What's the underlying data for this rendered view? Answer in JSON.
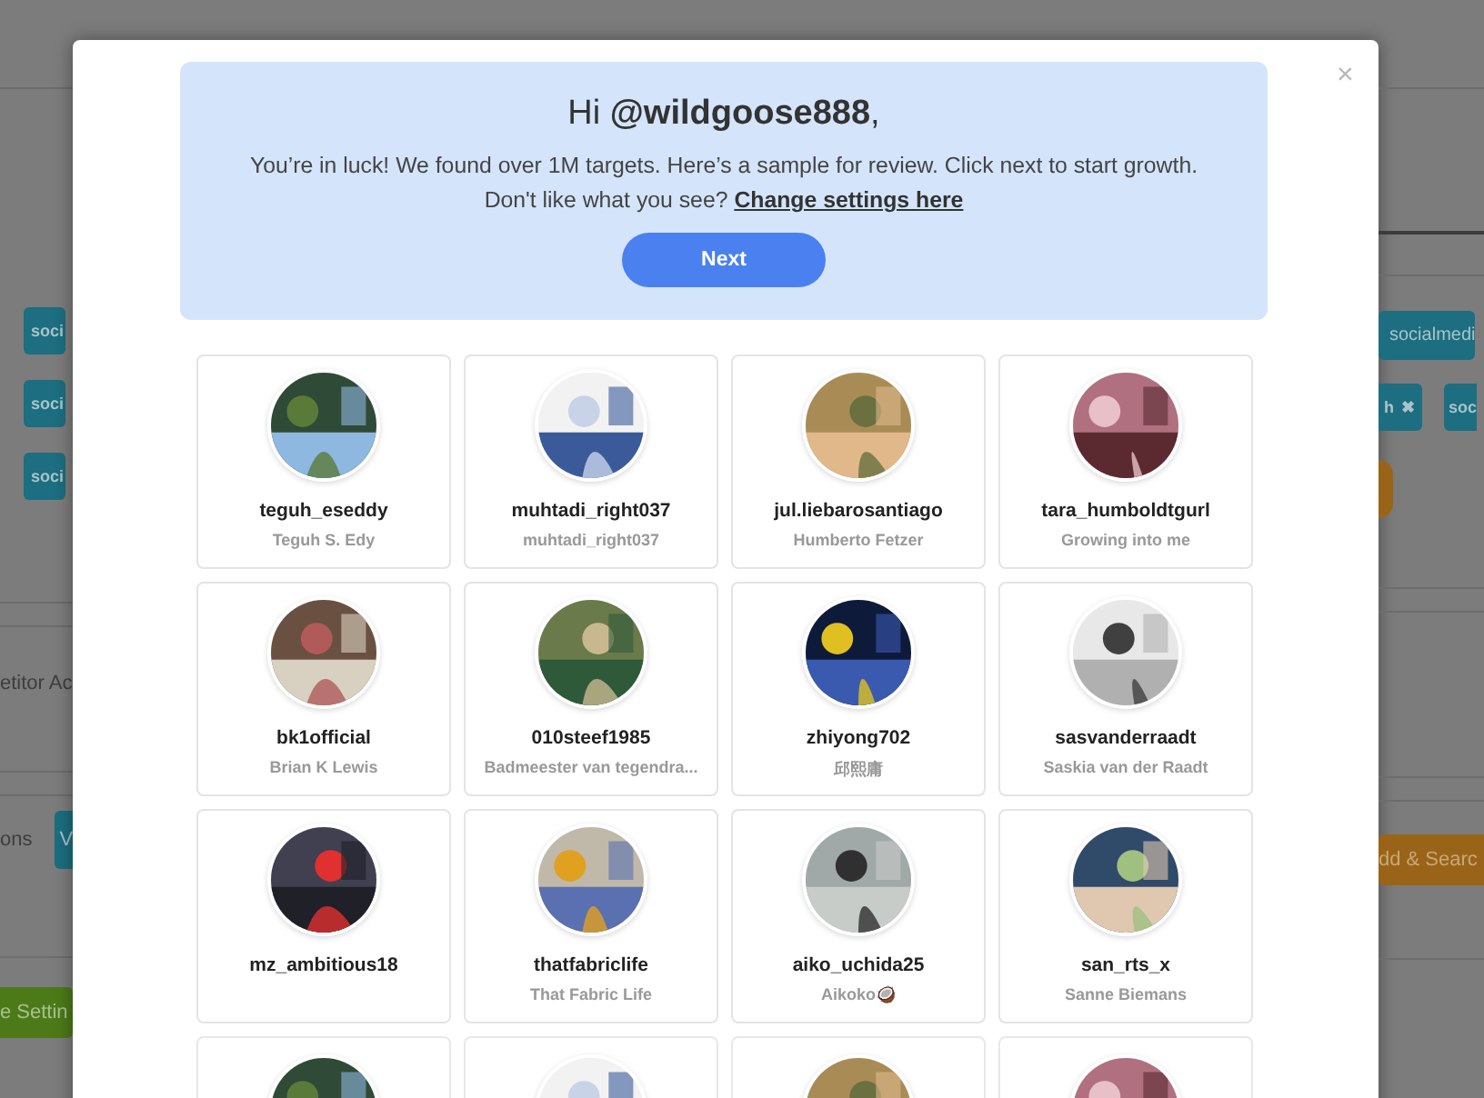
{
  "background": {
    "left": {
      "tags": [
        "soci",
        "soci",
        "soci"
      ],
      "label_1": "etitor Ac",
      "label_2": "ons",
      "tag_button": "V",
      "settings_button": "e Settin"
    },
    "right": {
      "tags": [
        "socialmedi"
      ],
      "removable_tag": "h",
      "remove_mark": "✖",
      "tag_2": "soc",
      "search_button": "dd & Searc"
    }
  },
  "modal": {
    "close": "×",
    "banner": {
      "greeting": "Hi **@wildgoose888**,",
      "message": "You’re in luck! We found over 1M targets. Here’s a sample for review. Click next to start growth.",
      "prompt": "Don't like what you see? ",
      "link": "Change settings here",
      "button": "Next"
    },
    "cards": [
      {
        "username": "teguh_eseddy",
        "name": "Teguh S. Edy"
      },
      {
        "username": "muhtadi_right037",
        "name": "muhtadi_right037"
      },
      {
        "username": "jul.liebarosantiago",
        "name": "Humberto Fetzer"
      },
      {
        "username": "tara_humboldtgurl",
        "name": "Growing into me"
      },
      {
        "username": "bk1official",
        "name": "Brian K Lewis"
      },
      {
        "username": "010steef1985",
        "name": "Badmeester van tegendra..."
      },
      {
        "username": "zhiyong702",
        "name": "邱熙庸"
      },
      {
        "username": "sasvanderraadt",
        "name": "Saskia van der Raadt"
      },
      {
        "username": "mz_ambitious18"
      },
      {
        "username": "thatfabriclife",
        "name": "That Fabric Life"
      },
      {
        "username": "aiko_uchida25",
        "name": "Aikoko🥥"
      },
      {
        "username": "san_rts_x",
        "name": "Sanne Biemans"
      },
      {
        "kind": "picture"
      },
      {
        "kind": "picture"
      },
      {
        "kind": "picture"
      },
      {
        "kind": "picture"
      }
    ]
  }
}
